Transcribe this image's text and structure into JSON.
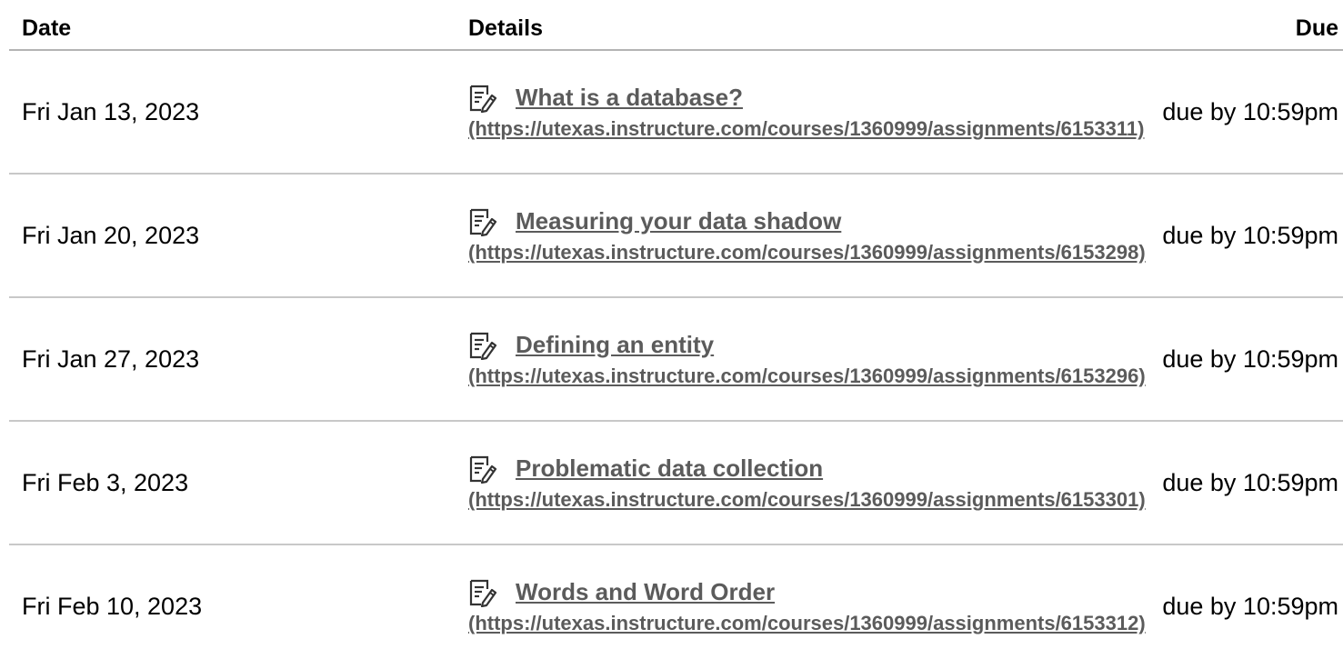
{
  "table": {
    "headers": {
      "date": "Date",
      "details": "Details",
      "due": "Due"
    },
    "rows": [
      {
        "date": "Fri Jan 13, 2023",
        "icon": "assignment-icon",
        "title": "What is a database?",
        "url": "(https://utexas.instructure.com/courses/1360999/assignments/6153311)",
        "due": "due by 10:59pm"
      },
      {
        "date": "Fri Jan 20, 2023",
        "icon": "assignment-icon",
        "title": "Measuring your data shadow",
        "url": "(https://utexas.instructure.com/courses/1360999/assignments/6153298)",
        "due": "due by 10:59pm"
      },
      {
        "date": "Fri Jan 27, 2023",
        "icon": "assignment-icon",
        "title": "Defining an entity",
        "url": "(https://utexas.instructure.com/courses/1360999/assignments/6153296)",
        "due": "due by 10:59pm"
      },
      {
        "date": "Fri Feb 3, 2023",
        "icon": "assignment-icon",
        "title": "Problematic data collection",
        "url": "(https://utexas.instructure.com/courses/1360999/assignments/6153301)",
        "due": "due by 10:59pm"
      },
      {
        "date": "Fri Feb 10, 2023",
        "icon": "assignment-icon",
        "title": "Words and Word Order",
        "url": "(https://utexas.instructure.com/courses/1360999/assignments/6153312)",
        "due": "due by 10:59pm"
      }
    ]
  },
  "colors": {
    "link": "#5b5b5b",
    "divider": "#c8c8c8"
  }
}
